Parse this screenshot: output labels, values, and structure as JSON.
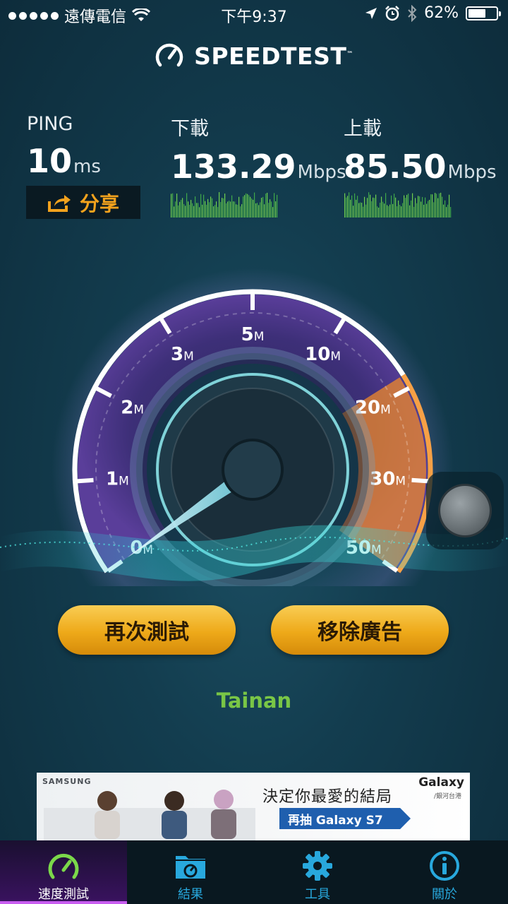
{
  "status_bar": {
    "carrier": "遠傳電信",
    "time": "下午9:37",
    "battery": "62%",
    "battery_level": 0.62
  },
  "app": {
    "logo_text": "SPEEDTEST",
    "trademark": "™"
  },
  "metrics": {
    "ping": {
      "label": "PING",
      "value": "10",
      "unit": "ms"
    },
    "download": {
      "label": "下載",
      "value": "133.29",
      "unit": "Mbps"
    },
    "upload": {
      "label": "上載",
      "value": "85.50",
      "unit": "Mbps"
    }
  },
  "share": {
    "label": "分享"
  },
  "gauge": {
    "ticks": [
      {
        "num": "0",
        "unit": "M"
      },
      {
        "num": "1",
        "unit": "M"
      },
      {
        "num": "2",
        "unit": "M"
      },
      {
        "num": "3",
        "unit": "M"
      },
      {
        "num": "5",
        "unit": "M"
      },
      {
        "num": "10",
        "unit": "M"
      },
      {
        "num": "20",
        "unit": "M"
      },
      {
        "num": "30",
        "unit": "M"
      },
      {
        "num": "50",
        "unit": "M"
      }
    ],
    "needle_value": "0",
    "colors": {
      "arc": "#ffffff",
      "face": "#4a3a86",
      "accent": "#f08a2a",
      "needle": "#8fe3f0"
    }
  },
  "buttons": {
    "retest": "再次測試",
    "remove_ads": "移除廣告"
  },
  "server": "Tainan",
  "ad": {
    "brand": "SAMSUNG",
    "headline": "決定你最愛的結局",
    "cta": "再抽 Galaxy S7",
    "product": "Galaxy",
    "product_sub": "/銀河台港"
  },
  "tabbar": {
    "items": [
      {
        "label": "速度測試",
        "icon": "speedometer-icon",
        "active": true
      },
      {
        "label": "結果",
        "icon": "results-folder-icon",
        "active": false
      },
      {
        "label": "工具",
        "icon": "gear-icon",
        "active": false
      },
      {
        "label": "關於",
        "icon": "info-icon",
        "active": false
      }
    ]
  },
  "theme": {
    "accent_orange": "#eea919",
    "accent_green": "#79c646",
    "tab_blue": "#28a8dd",
    "active_tab": "#c85df0"
  }
}
